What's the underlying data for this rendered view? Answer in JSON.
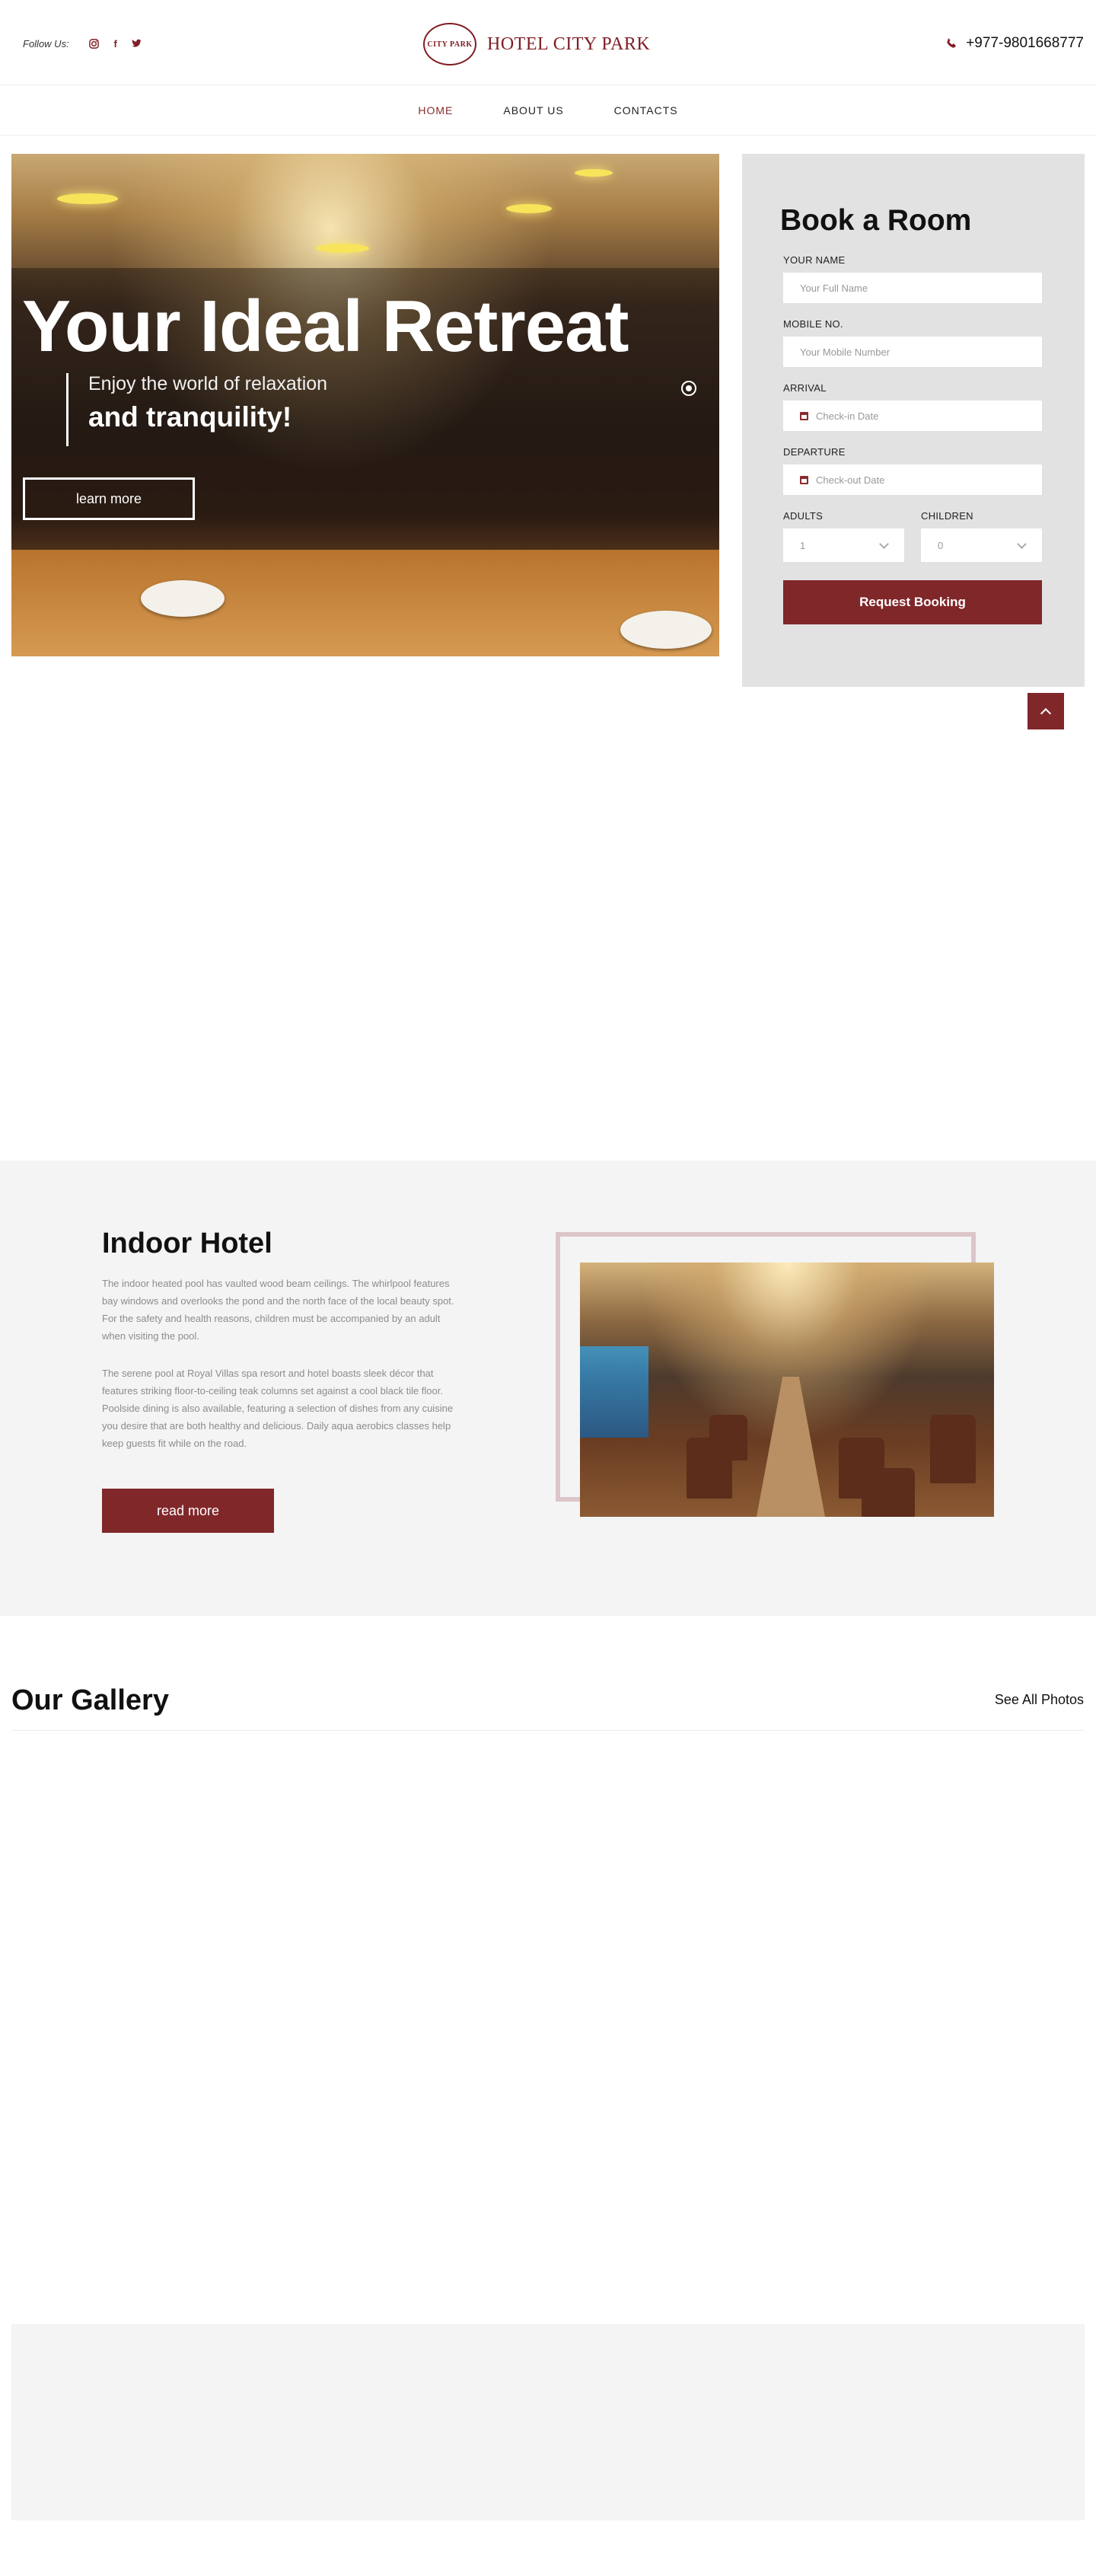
{
  "header": {
    "follow_label": "Follow Us:",
    "social_icons": [
      "instagram-icon",
      "facebook-icon",
      "twitter-icon"
    ],
    "logo_mark": "CITY PARK",
    "logo_text": "HOTEL CITY PARK",
    "phone": "+977-9801668777"
  },
  "nav": {
    "items": [
      {
        "label": "HOME",
        "active": true
      },
      {
        "label": "ABOUT US",
        "active": false
      },
      {
        "label": "CONTACTS",
        "active": false
      }
    ]
  },
  "hero": {
    "title": "Your Ideal Retreat",
    "subtitle_1": "Enjoy the world of relaxation",
    "subtitle_2": "and tranquility!",
    "button": "learn more"
  },
  "booking": {
    "title": "Book a Room",
    "name_label": "YOUR NAME",
    "name_placeholder": "Your Full Name",
    "mobile_label": "MOBILE NO.",
    "mobile_placeholder": "Your Mobile Number",
    "arrival_label": "ARRIVAL",
    "arrival_placeholder": "Check-in Date",
    "departure_label": "DEPARTURE",
    "departure_placeholder": "Check-out Date",
    "adults_label": "ADULTS",
    "adults_value": "1",
    "children_label": "CHILDREN",
    "children_value": "0",
    "button": "Request Booking"
  },
  "indoor": {
    "title": "Indoor Hotel",
    "paragraph_1": "The indoor heated pool has vaulted wood beam ceilings. The whirlpool features bay windows and overlooks the pond and the north face of the local beauty spot. For the safety and health reasons, children must be accompanied by an adult when visiting the pool.",
    "paragraph_2": "The serene pool at Royal Villas spa resort and hotel boasts sleek décor that features striking floor-to-ceiling teak columns set against a cool black tile floor. Poolside dining is also available, featuring a selection of dishes from any cuisine you desire that are both healthy and delicious. Daily aqua aerobics classes help keep guests fit while on the road.",
    "button": "read more"
  },
  "gallery": {
    "title": "Our Gallery",
    "see_all": "See All Photos"
  },
  "colors": {
    "brand": "#80272a",
    "panel": "#e2e2e2",
    "section_bg": "#f4f4f4"
  }
}
